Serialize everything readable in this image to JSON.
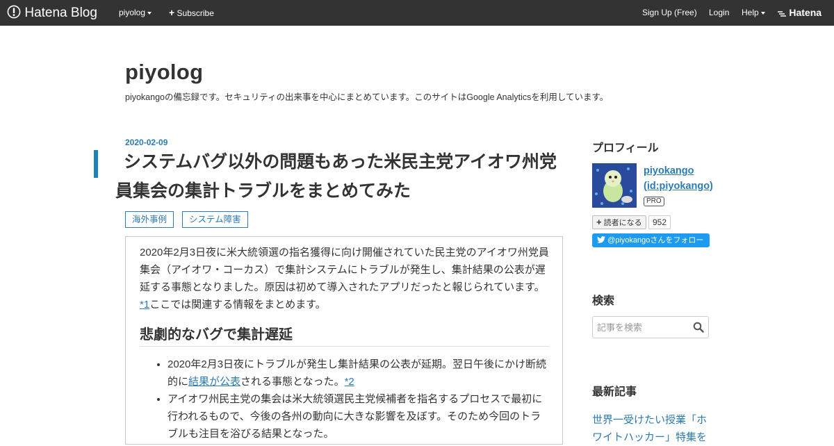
{
  "topbar": {
    "logo": "Hatena Blog",
    "blog_menu": "piyolog",
    "subscribe": "Subscribe",
    "signup": "Sign Up (Free)",
    "login": "Login",
    "help": "Help",
    "hatena": "Hatena"
  },
  "blog": {
    "title": "piyolog",
    "description": "piyokangoの備忘録です。セキュリティの出来事を中心にまとめています。このサイトはGoogle Analyticsを利用しています。"
  },
  "entry": {
    "date": "2020-02-09",
    "title": "システムバグ以外の問題もあった米民主党アイオワ州党員集会の集計トラブルをまとめてみた",
    "categories": [
      "海外事例",
      "システム障害"
    ],
    "intro_text": "2020年2月3日夜に米大統領選の指名獲得に向け開催されていた民主党のアイオワ州党員集会（アイオワ・コーカス）で集計システムにトラブルが発生し、集計結果の公表が遅延する事態となりました。原因は初めて導入されたアプリだったと報じられています。",
    "intro_footnote": "*1",
    "intro_tail": "ここでは関連する情報をまとめます。",
    "section_heading": "悲劇的なバグで集計遅延",
    "bullet1_a": "2020年2月3日夜にトラブルが発生し集計結果の公表が延期。翌日午後にかけ断続的に",
    "bullet1_link": "結果が公表",
    "bullet1_b": "される事態となった。",
    "bullet1_footnote": "*2",
    "bullet2": "アイオワ州民主党の集会は米大統領選民主党候補者を指名するプロセスで最初に行われるもので、今後の各州の動向に大きな影響を及ぼす。そのため今回のトラブルも注目を浴びる結果となった。"
  },
  "sidebar": {
    "profile_heading": "プロフィール",
    "profile_name": "piyokango",
    "profile_id": "(id:piyokango)",
    "pro_badge": "PRO",
    "subscribe_label": "読者になる",
    "subscriber_count": "952",
    "twitter_follow": "@piyokangoさんをフォロー",
    "search_heading": "検索",
    "search_placeholder": "記事を検索",
    "recent_heading": "最新記事",
    "recent_article": "世界一受けたい授業「ホワイトハッカー」特集を"
  },
  "colors": {
    "topbar_bg": "#333333",
    "accent": "#2d7bb3",
    "title_bar": "#1c84b8",
    "twitter": "#1d9bf0"
  }
}
